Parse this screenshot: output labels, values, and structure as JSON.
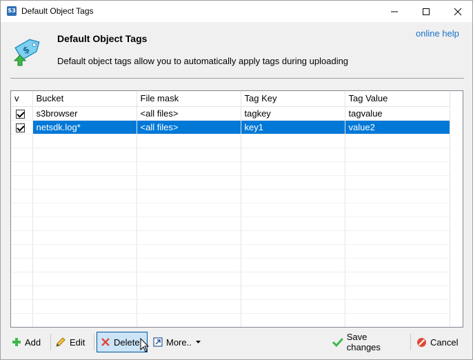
{
  "window": {
    "icon_text": "S3",
    "title": "Default Object Tags",
    "min_glyph": "—",
    "max_glyph": "☐",
    "close_glyph": "✕"
  },
  "header": {
    "title": "Default Object Tags",
    "description": "Default object tags allow you to automatically apply tags during uploading",
    "online_help": "online help",
    "icon": "tag-icon"
  },
  "grid": {
    "columns": [
      "v",
      "Bucket",
      "File mask",
      "Tag Key",
      "Tag Value"
    ],
    "rows": [
      {
        "checked": true,
        "bucket": "s3browser",
        "mask": "<all files>",
        "key": "tagkey",
        "value": "tagvalue",
        "selected": false
      },
      {
        "checked": true,
        "bucket": "netsdk.log*",
        "mask": "<all files>",
        "key": "key1",
        "value": "value2",
        "selected": true
      }
    ]
  },
  "toolbar": {
    "add": "Add",
    "edit": "Edit",
    "delete": "Delete",
    "more": "More..",
    "save": "Save changes",
    "cancel": "Cancel"
  },
  "colors": {
    "selection": "#0078d7",
    "link": "#1a6fc9",
    "hover_button": "#cce4f7"
  }
}
